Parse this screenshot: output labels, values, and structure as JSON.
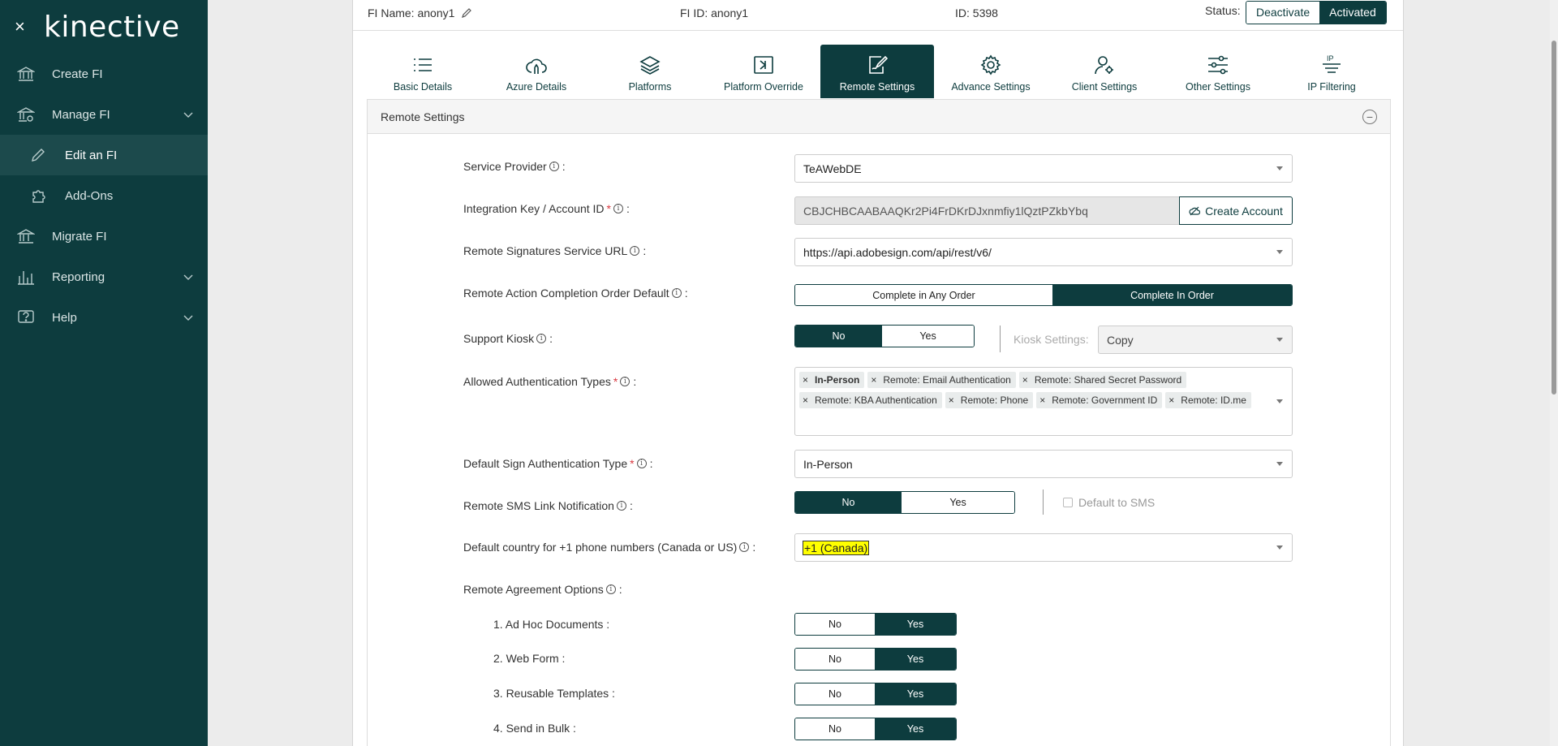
{
  "sidebar": {
    "close": "×",
    "logo": "kinective",
    "items": [
      {
        "label": "Create FI"
      },
      {
        "label": "Manage FI"
      },
      {
        "label": "Edit an FI"
      },
      {
        "label": "Add-Ons"
      },
      {
        "label": "Migrate FI"
      },
      {
        "label": "Reporting"
      },
      {
        "label": "Help"
      }
    ]
  },
  "topbar": {
    "fi_name": "FI Name: anony1",
    "fi_id": "FI ID: anony1",
    "id": "ID: 5398",
    "status_label": "Status:",
    "deactivate": "Deactivate",
    "activated": "Activated"
  },
  "tabs": [
    {
      "label": "Basic Details"
    },
    {
      "label": "Azure Details"
    },
    {
      "label": "Platforms"
    },
    {
      "label": "Platform Override"
    },
    {
      "label": "Remote Settings"
    },
    {
      "label": "Advance Settings"
    },
    {
      "label": "Client Settings"
    },
    {
      "label": "Other Settings"
    },
    {
      "label": "IP Filtering"
    }
  ],
  "section": {
    "title": "Remote Settings",
    "collapse": "−"
  },
  "form": {
    "service_provider": {
      "label": "Service Provider",
      "value": "TeAWebDE"
    },
    "integration_key": {
      "label": "Integration Key / Account ID",
      "value": "CBJCHBCAABAAQKr2Pi4FrDKrDJxnmfiy1lQztPZkbYbq",
      "button": "Create Account"
    },
    "remote_url": {
      "label": "Remote Signatures Service URL",
      "value": "https://api.adobesign.com/api/rest/v6/"
    },
    "completion_order": {
      "label": "Remote Action Completion Order Default",
      "opt1": "Complete in Any Order",
      "opt2": "Complete In Order"
    },
    "support_kiosk": {
      "label": "Support Kiosk",
      "no": "No",
      "yes": "Yes",
      "kiosk_settings_label": "Kiosk Settings:",
      "kiosk_settings_value": "Copy"
    },
    "auth_types": {
      "label": "Allowed Authentication Types",
      "tags": [
        "In-Person",
        "Remote: Email Authentication",
        "Remote: Shared Secret Password",
        "Remote: KBA Authentication",
        "Remote: Phone",
        "Remote: Government ID",
        "Remote: ID.me"
      ]
    },
    "default_sign_auth": {
      "label": "Default Sign Authentication Type",
      "value": "In-Person"
    },
    "sms_link": {
      "label": "Remote SMS Link Notification",
      "no": "No",
      "yes": "Yes",
      "default_sms": "Default to SMS"
    },
    "default_country": {
      "label": "Default country for +1 phone numbers (Canada or US)",
      "value": "+1 (Canada)"
    },
    "agreement_options": {
      "label": "Remote Agreement Options"
    },
    "options": [
      {
        "label": "1. Ad Hoc Documents :",
        "no": "No",
        "yes": "Yes"
      },
      {
        "label": "2. Web Form :",
        "no": "No",
        "yes": "Yes"
      },
      {
        "label": "3. Reusable Templates :",
        "no": "No",
        "yes": "Yes"
      },
      {
        "label": "4. Send in Bulk :",
        "no": "No",
        "yes": "Yes"
      }
    ]
  },
  "colors": {
    "primary": "#0d3c3e",
    "highlight": "#ffff00",
    "required": "#d9363e"
  }
}
